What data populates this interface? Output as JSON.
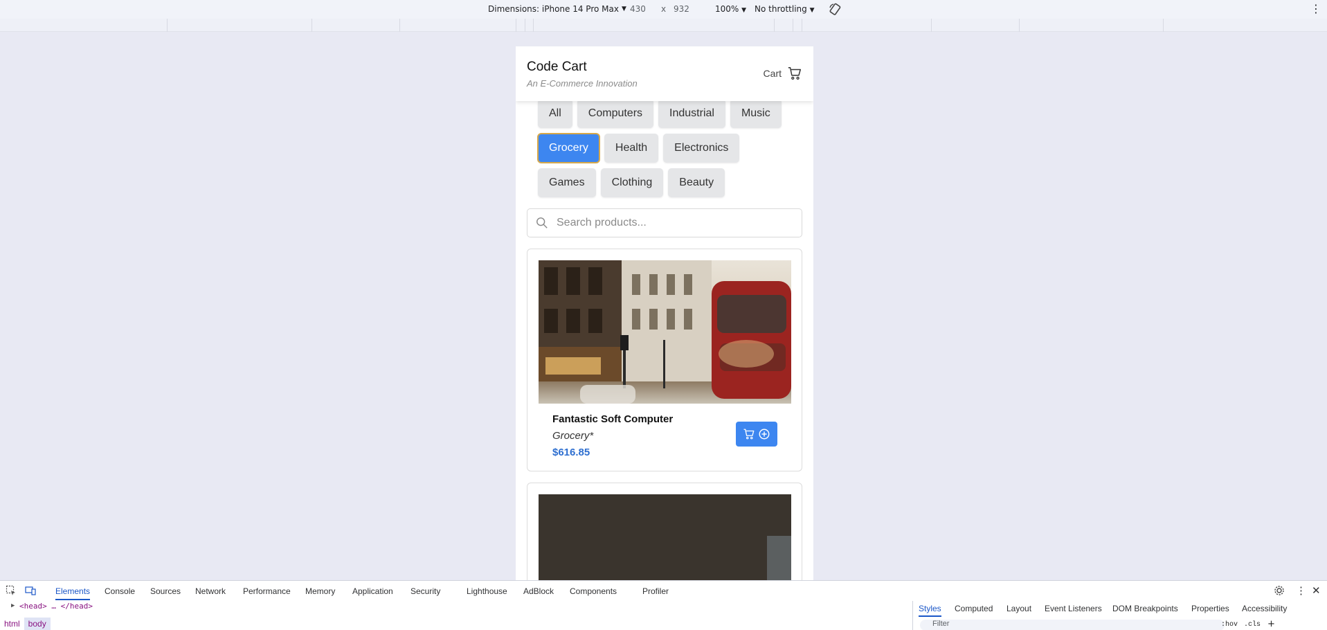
{
  "device_toolbar": {
    "dimensions_label": "Dimensions: iPhone 14 Pro Max",
    "width": "430",
    "times": "x",
    "height": "932",
    "zoom": "100%",
    "throttling": "No throttling"
  },
  "app": {
    "title": "Code Cart",
    "subtitle": "An E-Commerce Innovation",
    "cart_label": "Cart"
  },
  "categories": {
    "row1": [
      "All",
      "Computers",
      "Industrial",
      "Music"
    ],
    "row2": [
      "Grocery",
      "Health",
      "Electronics"
    ],
    "row3": [
      "Games",
      "Clothing",
      "Beauty"
    ],
    "selected": "Grocery"
  },
  "search": {
    "placeholder": "Search products..."
  },
  "products": [
    {
      "name": "Fantastic Soft Computer",
      "category": "Grocery*",
      "price": "$616.85",
      "image": "city-street-bus-photo"
    },
    {
      "image": "dark-photo"
    }
  ],
  "devtools": {
    "tabs": [
      "Elements",
      "Console",
      "Sources",
      "Network",
      "Performance",
      "Memory",
      "Application",
      "Security",
      "Lighthouse",
      "AdBlock",
      "Components",
      "Profiler"
    ],
    "active_tab": "Elements",
    "dom_head": "<head> … </head>",
    "breadcrumbs": [
      "html",
      "body"
    ],
    "styles_tabs": [
      "Styles",
      "Computed",
      "Layout",
      "Event Listeners",
      "DOM Breakpoints",
      "Properties",
      "Accessibility"
    ],
    "styles_active": "Styles",
    "filter_placeholder": "Filter",
    "hov": ":hov",
    "cls": ".cls"
  },
  "colors": {
    "accent": "#3d86f0",
    "price": "#2e6fd0",
    "page_bg": "#e8e9f3"
  }
}
